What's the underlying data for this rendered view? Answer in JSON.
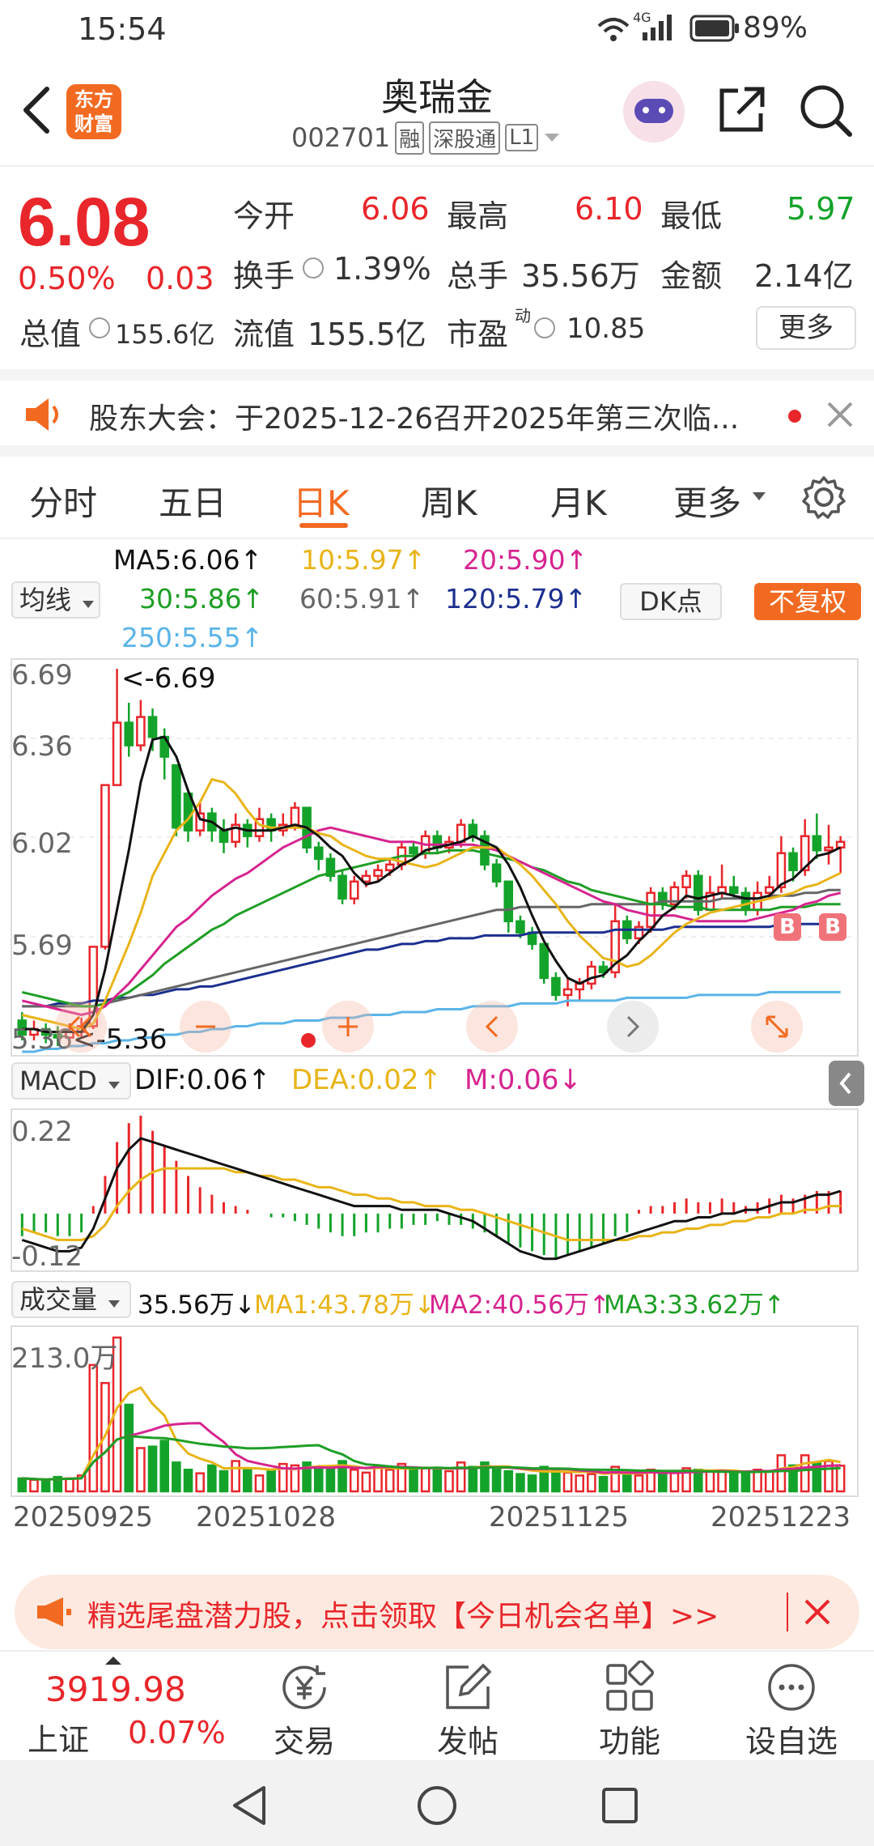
{
  "status": {
    "time": "15:54",
    "network": "4G",
    "battery": "89%"
  },
  "header": {
    "logo_top": "东方",
    "logo_bottom": "财富",
    "title": "奥瑞金",
    "code": "002701",
    "tags": [
      "融",
      "深股通",
      "L1"
    ]
  },
  "quote": {
    "price": "6.08",
    "change_pct": "0.50%",
    "change": "0.03",
    "open_label": "今开",
    "open": "6.06",
    "high_label": "最高",
    "high": "6.10",
    "low_label": "最低",
    "low": "5.97",
    "turnover_label": "换手",
    "turnover": "1.39%",
    "volume_label": "总手",
    "volume": "35.56万",
    "amount_label": "金额",
    "amount": "2.14亿",
    "mktcap_label": "总值",
    "mktcap": "155.6亿",
    "float_label": "流值",
    "float": "155.5亿",
    "pe_label": "市盈",
    "pe_sup": "动",
    "pe": "10.85",
    "more_label": "更多"
  },
  "notice": {
    "text": "股东大会：于2025-12-26召开2025年第三次临..."
  },
  "tabs": [
    "分时",
    "五日",
    "日K",
    "周K",
    "月K",
    "更多"
  ],
  "active_tab": "日K",
  "ma": {
    "selector": "均线",
    "ma5": "MA5:6.06↑",
    "ma10": "10:5.97↑",
    "ma20": "20:5.90↑",
    "ma30": "30:5.86↑",
    "ma60": "60:5.91↑",
    "ma120": "120:5.79↑",
    "ma250": "250:5.55↑",
    "dk_label": "DK点",
    "fq_label": "不复权"
  },
  "kline": {
    "y_labels": [
      "6.69",
      "6.36",
      "6.02",
      "5.69",
      "5.36"
    ],
    "high_marker": "<-6.69",
    "low_marker": "<-5.36",
    "signal_label": "B",
    "ohlc": [
      [
        5.45,
        5.4,
        5.48,
        5.38
      ],
      [
        5.4,
        5.42,
        5.45,
        5.38
      ],
      [
        5.42,
        5.4,
        5.44,
        5.37
      ],
      [
        5.4,
        5.39,
        5.43,
        5.36
      ],
      [
        5.39,
        5.41,
        5.44,
        5.37
      ],
      [
        5.41,
        5.43,
        5.46,
        5.39
      ],
      [
        5.43,
        5.71,
        5.71,
        5.42
      ],
      [
        5.71,
        6.28,
        6.28,
        5.7
      ],
      [
        6.28,
        6.5,
        6.69,
        6.4
      ],
      [
        6.5,
        6.42,
        6.57,
        6.38
      ],
      [
        6.42,
        6.52,
        6.58,
        6.4
      ],
      [
        6.52,
        6.45,
        6.55,
        6.4
      ],
      [
        6.45,
        6.38,
        6.48,
        6.3
      ],
      [
        6.35,
        6.13,
        6.25,
        6.1
      ],
      [
        6.25,
        6.12,
        6.26,
        6.08
      ],
      [
        6.12,
        6.18,
        6.22,
        6.1
      ],
      [
        6.18,
        6.12,
        6.2,
        6.08
      ],
      [
        6.12,
        6.08,
        6.16,
        6.04
      ],
      [
        6.08,
        6.14,
        6.18,
        6.06
      ],
      [
        6.14,
        6.1,
        6.16,
        6.06
      ],
      [
        6.1,
        6.16,
        6.2,
        6.08
      ],
      [
        6.16,
        6.12,
        6.18,
        6.08
      ],
      [
        6.12,
        6.14,
        6.18,
        6.1
      ],
      [
        6.14,
        6.2,
        6.22,
        6.12
      ],
      [
        6.2,
        6.06,
        6.2,
        6.04
      ],
      [
        6.06,
        6.02,
        6.08,
        5.98
      ],
      [
        6.02,
        5.96,
        6.04,
        5.94
      ],
      [
        5.96,
        5.88,
        5.98,
        5.86
      ],
      [
        5.88,
        5.94,
        5.96,
        5.86
      ],
      [
        5.94,
        5.96,
        5.98,
        5.92
      ],
      [
        5.96,
        5.98,
        6.0,
        5.94
      ],
      [
        5.98,
        6.0,
        6.02,
        5.96
      ],
      [
        6.0,
        6.06,
        6.08,
        5.98
      ],
      [
        6.06,
        6.04,
        6.08,
        6.02
      ],
      [
        6.04,
        6.1,
        6.12,
        6.02
      ],
      [
        6.1,
        6.06,
        6.12,
        6.04
      ],
      [
        6.06,
        6.08,
        6.1,
        6.04
      ],
      [
        6.08,
        6.14,
        6.16,
        6.06
      ],
      [
        6.14,
        6.1,
        6.16,
        6.08
      ],
      [
        6.1,
        6.0,
        6.12,
        5.98
      ],
      [
        6.0,
        5.94,
        6.02,
        5.92
      ],
      [
        5.94,
        5.8,
        5.94,
        5.76
      ],
      [
        5.8,
        5.76,
        5.82,
        5.74
      ],
      [
        5.76,
        5.72,
        5.78,
        5.7
      ],
      [
        5.72,
        5.6,
        5.72,
        5.58
      ],
      [
        5.6,
        5.54,
        5.62,
        5.52
      ],
      [
        5.54,
        5.56,
        5.6,
        5.5
      ],
      [
        5.56,
        5.58,
        5.6,
        5.52
      ],
      [
        5.58,
        5.64,
        5.66,
        5.56
      ],
      [
        5.64,
        5.62,
        5.66,
        5.6
      ],
      [
        5.62,
        5.8,
        5.86,
        5.6
      ],
      [
        5.8,
        5.74,
        5.82,
        5.72
      ],
      [
        5.74,
        5.78,
        5.8,
        5.72
      ],
      [
        5.78,
        5.9,
        5.92,
        5.76
      ],
      [
        5.9,
        5.86,
        5.92,
        5.84
      ],
      [
        5.86,
        5.92,
        5.94,
        5.84
      ],
      [
        5.92,
        5.96,
        5.98,
        5.88
      ],
      [
        5.96,
        5.84,
        5.98,
        5.82
      ],
      [
        5.84,
        5.9,
        5.96,
        5.84
      ],
      [
        5.9,
        5.92,
        6.0,
        5.88
      ],
      [
        5.92,
        5.9,
        5.96,
        5.88
      ],
      [
        5.9,
        5.84,
        5.92,
        5.82
      ],
      [
        5.84,
        5.9,
        5.94,
        5.82
      ],
      [
        5.9,
        5.92,
        5.96,
        5.88
      ],
      [
        5.92,
        6.04,
        6.1,
        5.9
      ],
      [
        6.04,
        5.98,
        6.06,
        5.94
      ],
      [
        5.98,
        6.1,
        6.16,
        5.96
      ],
      [
        6.1,
        6.05,
        6.18,
        6.02
      ],
      [
        6.05,
        6.06,
        6.14,
        6.0
      ],
      [
        6.06,
        6.08,
        6.1,
        5.97
      ]
    ],
    "ma5": [
      5.42,
      5.42,
      5.41,
      5.41,
      5.41,
      5.41,
      5.47,
      5.63,
      5.84,
      6.05,
      6.29,
      6.44,
      6.45,
      6.38,
      6.26,
      6.16,
      6.15,
      6.12,
      6.13,
      6.12,
      6.12,
      6.12,
      6.13,
      6.14,
      6.13,
      6.1,
      6.06,
      6.03,
      5.97,
      5.93,
      5.94,
      5.97,
      6.0,
      6.02,
      6.05,
      6.06,
      6.07,
      6.08,
      6.1,
      6.08,
      6.06,
      6.0,
      5.92,
      5.82,
      5.73,
      5.66,
      5.6,
      5.58,
      5.6,
      5.61,
      5.65,
      5.68,
      5.73,
      5.77,
      5.82,
      5.85,
      5.89,
      5.88,
      5.89,
      5.9,
      5.89,
      5.88,
      5.88,
      5.89,
      5.93,
      5.95,
      5.99,
      6.03,
      6.04,
      6.06
    ],
    "ma10": [
      5.47,
      5.46,
      5.45,
      5.44,
      5.43,
      5.42,
      5.44,
      5.52,
      5.62,
      5.72,
      5.83,
      5.96,
      6.04,
      6.12,
      6.16,
      6.22,
      6.3,
      6.29,
      6.25,
      6.19,
      6.14,
      6.13,
      6.13,
      6.13,
      6.13,
      6.11,
      6.1,
      6.07,
      6.05,
      6.03,
      6.02,
      6.02,
      6.01,
      6.0,
      5.99,
      6.0,
      6.02,
      6.04,
      6.06,
      6.06,
      6.06,
      6.03,
      6.0,
      5.96,
      5.91,
      5.86,
      5.8,
      5.75,
      5.71,
      5.67,
      5.66,
      5.64,
      5.65,
      5.68,
      5.72,
      5.76,
      5.79,
      5.81,
      5.83,
      5.84,
      5.85,
      5.86,
      5.87,
      5.88,
      5.89,
      5.9,
      5.92,
      5.93,
      5.95,
      5.97
    ],
    "ma20": [
      5.52,
      5.51,
      5.5,
      5.49,
      5.48,
      5.47,
      5.48,
      5.5,
      5.54,
      5.58,
      5.63,
      5.68,
      5.73,
      5.78,
      5.81,
      5.85,
      5.89,
      5.92,
      5.95,
      5.97,
      6.0,
      6.03,
      6.06,
      6.08,
      6.1,
      6.12,
      6.13,
      6.12,
      6.11,
      6.1,
      6.09,
      6.08,
      6.08,
      6.08,
      6.07,
      6.07,
      6.07,
      6.07,
      6.07,
      6.06,
      6.05,
      6.03,
      6.01,
      5.99,
      5.97,
      5.95,
      5.93,
      5.91,
      5.89,
      5.87,
      5.86,
      5.84,
      5.83,
      5.82,
      5.82,
      5.82,
      5.81,
      5.8,
      5.8,
      5.8,
      5.8,
      5.8,
      5.81,
      5.82,
      5.83,
      5.84,
      5.86,
      5.87,
      5.89,
      5.9
    ],
    "ma30": [
      5.55,
      5.54,
      5.53,
      5.52,
      5.51,
      5.5,
      5.5,
      5.51,
      5.53,
      5.55,
      5.58,
      5.61,
      5.65,
      5.68,
      5.71,
      5.74,
      5.77,
      5.79,
      5.82,
      5.84,
      5.86,
      5.88,
      5.9,
      5.92,
      5.94,
      5.96,
      5.97,
      5.98,
      5.99,
      6.0,
      6.01,
      6.02,
      6.03,
      6.03,
      6.04,
      6.04,
      6.05,
      6.05,
      6.05,
      6.04,
      6.03,
      6.02,
      6.01,
      5.99,
      5.98,
      5.96,
      5.94,
      5.93,
      5.91,
      5.9,
      5.89,
      5.88,
      5.87,
      5.86,
      5.86,
      5.85,
      5.85,
      5.85,
      5.84,
      5.84,
      5.84,
      5.84,
      5.84,
      5.84,
      5.85,
      5.85,
      5.85,
      5.86,
      5.86,
      5.86
    ],
    "ma60": [
      5.5,
      5.5,
      5.5,
      5.5,
      5.5,
      5.5,
      5.5,
      5.51,
      5.52,
      5.53,
      5.54,
      5.55,
      5.56,
      5.57,
      5.58,
      5.59,
      5.6,
      5.61,
      5.62,
      5.63,
      5.64,
      5.65,
      5.66,
      5.67,
      5.68,
      5.69,
      5.7,
      5.71,
      5.72,
      5.73,
      5.74,
      5.75,
      5.76,
      5.77,
      5.78,
      5.79,
      5.8,
      5.81,
      5.82,
      5.83,
      5.84,
      5.84,
      5.85,
      5.85,
      5.85,
      5.85,
      5.85,
      5.85,
      5.86,
      5.86,
      5.86,
      5.86,
      5.86,
      5.86,
      5.87,
      5.87,
      5.87,
      5.87,
      5.87,
      5.88,
      5.88,
      5.88,
      5.88,
      5.89,
      5.89,
      5.89,
      5.9,
      5.9,
      5.91,
      5.91
    ],
    "ma120": [
      5.5,
      5.5,
      5.5,
      5.51,
      5.51,
      5.51,
      5.52,
      5.52,
      5.53,
      5.53,
      5.54,
      5.54,
      5.55,
      5.56,
      5.56,
      5.57,
      5.57,
      5.58,
      5.59,
      5.6,
      5.61,
      5.62,
      5.63,
      5.64,
      5.65,
      5.66,
      5.67,
      5.68,
      5.69,
      5.7,
      5.7,
      5.71,
      5.72,
      5.72,
      5.73,
      5.73,
      5.74,
      5.74,
      5.74,
      5.75,
      5.75,
      5.75,
      5.75,
      5.76,
      5.76,
      5.76,
      5.76,
      5.76,
      5.76,
      5.76,
      5.77,
      5.77,
      5.77,
      5.77,
      5.77,
      5.78,
      5.78,
      5.78,
      5.78,
      5.78,
      5.78,
      5.78,
      5.78,
      5.78,
      5.79,
      5.79,
      5.79,
      5.79,
      5.79,
      5.79
    ],
    "ma250": [
      5.34,
      5.34,
      5.35,
      5.35,
      5.36,
      5.36,
      5.37,
      5.37,
      5.38,
      5.38,
      5.39,
      5.39,
      5.4,
      5.4,
      5.41,
      5.41,
      5.42,
      5.42,
      5.43,
      5.43,
      5.44,
      5.44,
      5.44,
      5.45,
      5.45,
      5.45,
      5.46,
      5.46,
      5.46,
      5.47,
      5.47,
      5.47,
      5.48,
      5.48,
      5.48,
      5.49,
      5.49,
      5.49,
      5.5,
      5.5,
      5.5,
      5.5,
      5.51,
      5.51,
      5.51,
      5.51,
      5.52,
      5.52,
      5.52,
      5.52,
      5.52,
      5.53,
      5.53,
      5.53,
      5.53,
      5.53,
      5.53,
      5.54,
      5.54,
      5.54,
      5.54,
      5.54,
      5.54,
      5.55,
      5.55,
      5.55,
      5.55,
      5.55,
      5.55,
      5.55
    ]
  },
  "macd": {
    "selector": "MACD",
    "dif": "DIF:0.06↑",
    "dea": "DEA:0.02↑",
    "m": "M:0.06↓",
    "y_top": "0.22",
    "y_bottom": "-0.12",
    "hist": [
      -0.06,
      -0.05,
      -0.05,
      -0.06,
      -0.06,
      -0.05,
      0.02,
      0.1,
      0.19,
      0.24,
      0.26,
      0.22,
      0.18,
      0.14,
      0.1,
      0.07,
      0.05,
      0.03,
      0.02,
      0.01,
      0.0,
      -0.01,
      -0.01,
      -0.02,
      -0.03,
      -0.04,
      -0.05,
      -0.06,
      -0.06,
      -0.05,
      -0.05,
      -0.04,
      -0.04,
      -0.03,
      -0.03,
      -0.02,
      -0.03,
      -0.03,
      -0.04,
      -0.05,
      -0.06,
      -0.08,
      -0.09,
      -0.1,
      -0.11,
      -0.12,
      -0.11,
      -0.1,
      -0.09,
      -0.08,
      -0.06,
      -0.05,
      0.01,
      0.02,
      0.02,
      0.03,
      0.04,
      0.03,
      0.03,
      0.04,
      0.03,
      0.02,
      0.03,
      0.04,
      0.05,
      0.04,
      0.05,
      0.06,
      0.06,
      0.06
    ],
    "dif_line": [
      -0.07,
      -0.08,
      -0.09,
      -0.1,
      -0.1,
      -0.09,
      -0.04,
      0.04,
      0.12,
      0.17,
      0.2,
      0.19,
      0.18,
      0.17,
      0.16,
      0.15,
      0.14,
      0.13,
      0.12,
      0.11,
      0.1,
      0.09,
      0.08,
      0.07,
      0.06,
      0.05,
      0.04,
      0.03,
      0.02,
      0.02,
      0.02,
      0.02,
      0.01,
      0.01,
      0.01,
      0.01,
      0.0,
      -0.01,
      -0.02,
      -0.04,
      -0.06,
      -0.08,
      -0.1,
      -0.11,
      -0.12,
      -0.12,
      -0.11,
      -0.1,
      -0.09,
      -0.08,
      -0.07,
      -0.06,
      -0.05,
      -0.04,
      -0.03,
      -0.02,
      -0.02,
      -0.01,
      -0.01,
      0.0,
      0.0,
      0.01,
      0.01,
      0.02,
      0.03,
      0.03,
      0.04,
      0.05,
      0.05,
      0.06
    ],
    "dea_line": [
      -0.04,
      -0.05,
      -0.06,
      -0.07,
      -0.07,
      -0.07,
      -0.06,
      -0.03,
      0.02,
      0.06,
      0.09,
      0.11,
      0.12,
      0.12,
      0.12,
      0.12,
      0.12,
      0.12,
      0.11,
      0.11,
      0.1,
      0.1,
      0.09,
      0.09,
      0.08,
      0.07,
      0.07,
      0.06,
      0.05,
      0.05,
      0.04,
      0.04,
      0.03,
      0.03,
      0.02,
      0.02,
      0.02,
      0.01,
      0.01,
      0.0,
      -0.01,
      -0.02,
      -0.03,
      -0.04,
      -0.05,
      -0.06,
      -0.07,
      -0.07,
      -0.07,
      -0.07,
      -0.07,
      -0.07,
      -0.06,
      -0.06,
      -0.05,
      -0.05,
      -0.04,
      -0.04,
      -0.03,
      -0.03,
      -0.02,
      -0.02,
      -0.01,
      -0.01,
      0.0,
      0.0,
      0.01,
      0.01,
      0.02,
      0.02
    ]
  },
  "volume": {
    "selector": "成交量",
    "vol": "35.56万↓",
    "ma1": "MA1:43.78万↓",
    "ma2": "MA2:40.56万↑",
    "ma3": "MA3:33.62万↑",
    "y_top": "213.0万",
    "y_max": 213,
    "bars": [
      18,
      16,
      15,
      20,
      18,
      22,
      175,
      150,
      213,
      120,
      60,
      62,
      70,
      40,
      30,
      25,
      36,
      28,
      42,
      30,
      22,
      28,
      38,
      36,
      40,
      32,
      30,
      42,
      30,
      26,
      34,
      30,
      38,
      30,
      32,
      30,
      28,
      40,
      34,
      40,
      30,
      28,
      24,
      22,
      34,
      30,
      26,
      22,
      24,
      20,
      34,
      24,
      22,
      30,
      26,
      28,
      32,
      30,
      28,
      28,
      26,
      24,
      30,
      28,
      50,
      36,
      50,
      40,
      42,
      35.56
    ]
  },
  "dates": [
    "20250925",
    "20251028",
    "20251125",
    "20251223"
  ],
  "ad": {
    "text": "精选尾盘潜力股，点击领取【今日机会名单】>>"
  },
  "bottom_nav": {
    "index_value": "3919.98",
    "index_name": "上证",
    "index_change": "0.07%",
    "items": [
      "交易",
      "发帖",
      "功能",
      "设自选"
    ]
  },
  "colors": {
    "up": "#e8262b",
    "down": "#14a32a",
    "ma5": "#111111",
    "ma10": "#e8b417",
    "ma20": "#d6248f",
    "ma30": "#1e9e25",
    "ma60": "#666666",
    "ma120": "#1c2f8f",
    "ma250": "#5ab4e8",
    "accent": "#f26a21"
  }
}
